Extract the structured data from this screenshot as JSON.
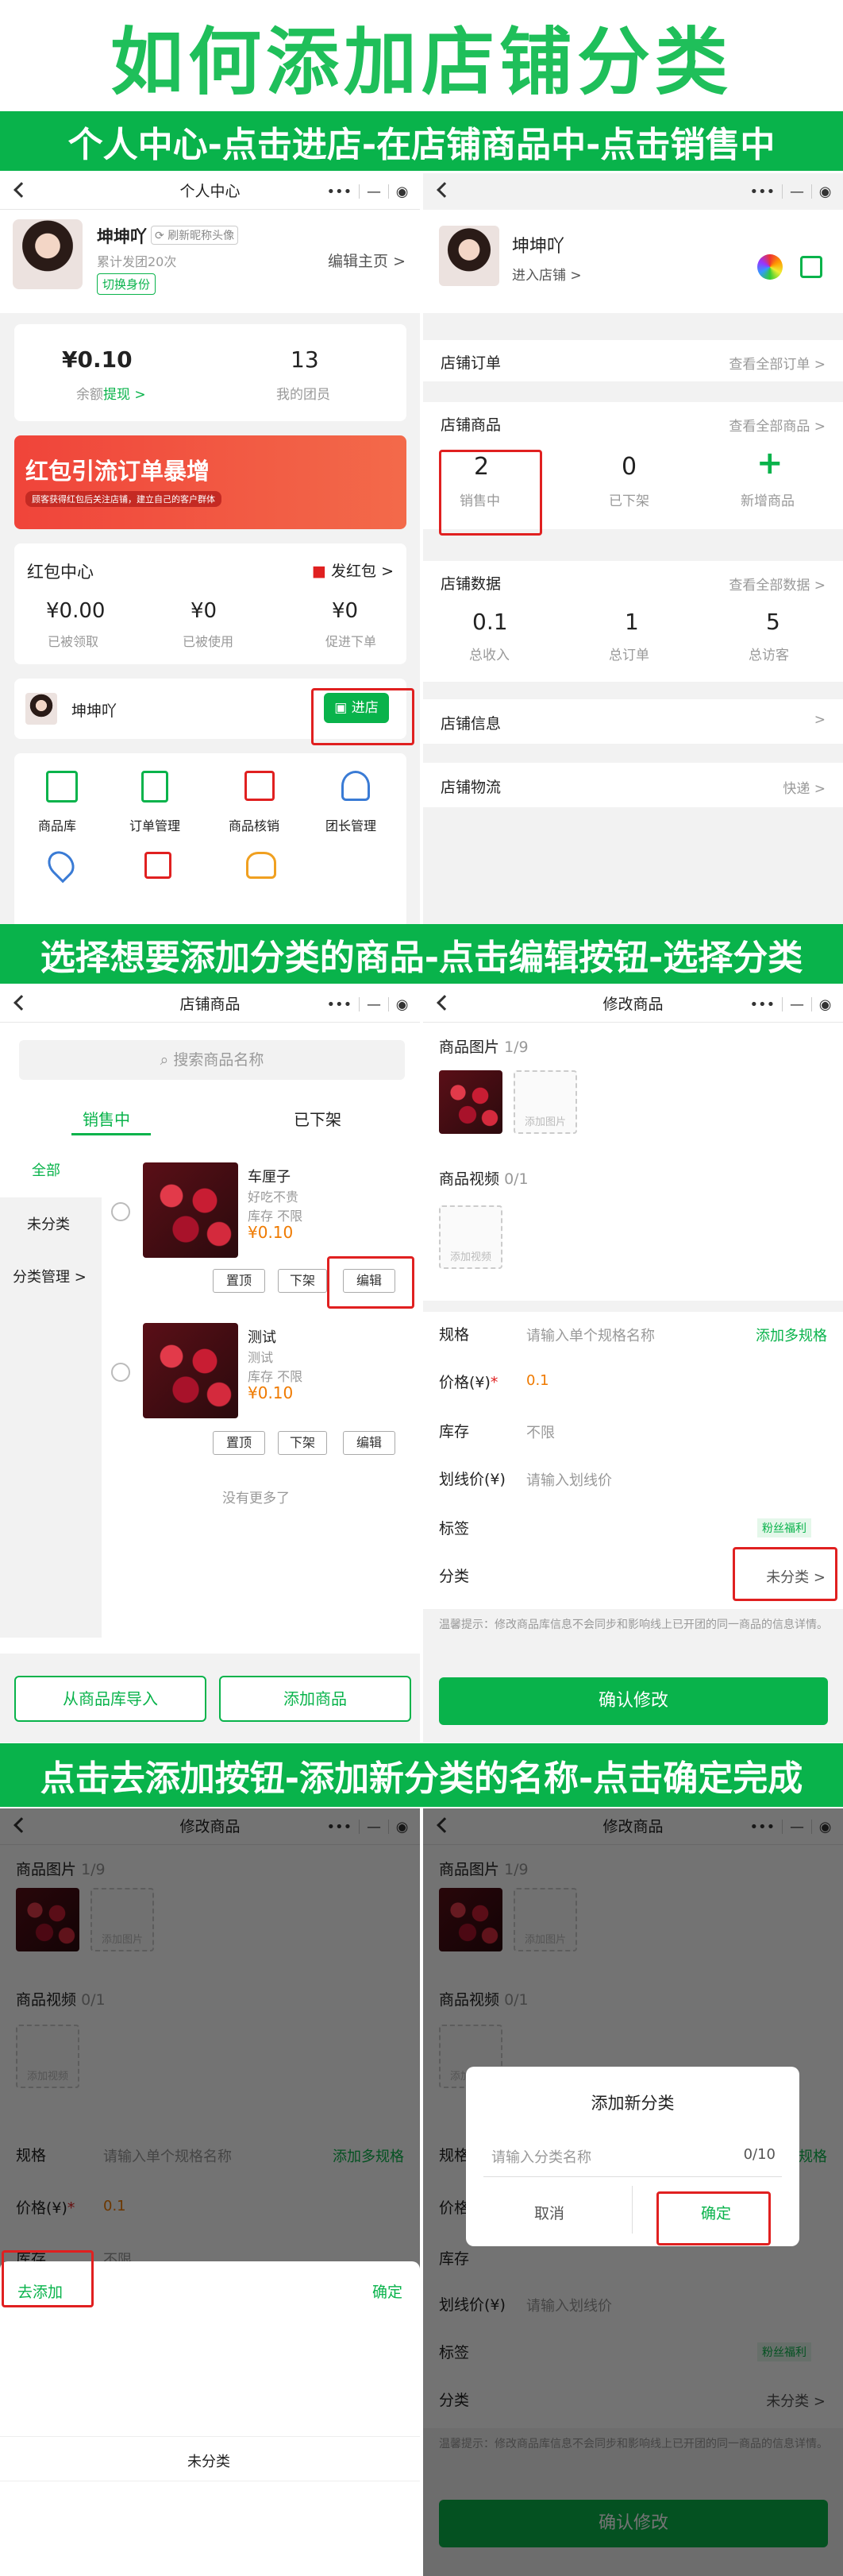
{
  "title": "如何添加店铺分类",
  "banners": [
    "个人中心-点击进店-在店铺商品中-点击销售中",
    "选择想要添加分类的商品-点击编辑按钮-选择分类",
    "点击去添加按钮-添加新分类的名称-点击确定完成"
  ],
  "p1": {
    "nav_title": "个人中心",
    "name": "坤坤吖",
    "refresh": "刷新昵称头像",
    "sub": "累计发团20次",
    "switch": "切换身份",
    "edit_home": "编辑主页 >",
    "balance": "¥0.10",
    "balance_label": "余额",
    "withdraw": "提现 >",
    "members": "13",
    "members_label": "我的团员",
    "ad_title": "红包引流订单暴增",
    "ad_sub": "顾客获得红包后关注店铺，建立自己的客户群体",
    "hb_title": "红包中心",
    "send_hb": "发红包 >",
    "hb": [
      {
        "v": "¥0.00",
        "l": "已被领取"
      },
      {
        "v": "¥0",
        "l": "已被使用"
      },
      {
        "v": "¥0",
        "l": "促进下单"
      }
    ],
    "shop_name": "坤坤吖",
    "enter_shop": "进店",
    "tools": [
      "商品库",
      "订单管理",
      "商品核销",
      "团长管理",
      "",
      "",
      "",
      ""
    ]
  },
  "p2": {
    "name": "坤坤吖",
    "enter": "进入店铺 >",
    "rows": {
      "orders": "店铺订单",
      "orders_r": "查看全部订单 >",
      "goods": "店铺商品",
      "goods_r": "查看全部商品 >",
      "data": "店铺数据",
      "data_r": "查看全部数据 >",
      "info": "店铺信息",
      "logistics": "店铺物流",
      "logistics_r": "快递 >"
    },
    "goods_stats": [
      {
        "v": "2",
        "l": "销售中"
      },
      {
        "v": "0",
        "l": "已下架"
      },
      {
        "v": "+",
        "l": "新增商品"
      }
    ],
    "data_stats": [
      {
        "v": "0.1",
        "l": "总收入"
      },
      {
        "v": "1",
        "l": "总订单"
      },
      {
        "v": "5",
        "l": "总访客"
      }
    ]
  },
  "p3": {
    "nav_title": "店铺商品",
    "search": "搜索商品名称",
    "tab_on": "销售中",
    "tab_off": "已下架",
    "side": [
      "全部",
      "未分类",
      "分类管理 >"
    ],
    "items": [
      {
        "name": "车厘子",
        "desc": "好吃不贵",
        "stock": "库存 不限",
        "price": "¥0.10"
      },
      {
        "name": "测试",
        "desc": "测试",
        "stock": "库存 不限",
        "price": "¥0.10"
      }
    ],
    "btns": [
      "置顶",
      "下架",
      "编辑"
    ],
    "nomore": "没有更多了",
    "import": "从商品库导入",
    "add": "添加商品"
  },
  "edit": {
    "nav_title": "修改商品",
    "pic": "商品图片",
    "pic_count": "1/9",
    "video": "商品视频",
    "video_count": "0/1",
    "add_pic": "添加图片",
    "add_video": "添加视频",
    "spec": "规格",
    "spec_ph": "请输入单个规格名称",
    "spec_add": "添加多规格",
    "price": "价格(¥)",
    "price_req": "*",
    "price_v": "0.1",
    "stock": "库存",
    "stock_v": "不限",
    "line": "划线价(¥)",
    "line_ph": "请输入划线价",
    "tag": "标签",
    "tag_v": "粉丝福利",
    "cat": "分类",
    "cat_v": "未分类 >",
    "tip": "温馨提示：修改商品库信息不会同步和影响线上已开团的同一商品的信息详情。",
    "confirm": "确认修改"
  },
  "p5": {
    "go_add": "去添加",
    "ok": "确定",
    "cat": "未分类"
  },
  "p6": {
    "dlg_title": "添加新分类",
    "dlg_ph": "请输入分类名称",
    "dlg_count": "0/10",
    "cancel": "取消",
    "ok": "确定"
  }
}
